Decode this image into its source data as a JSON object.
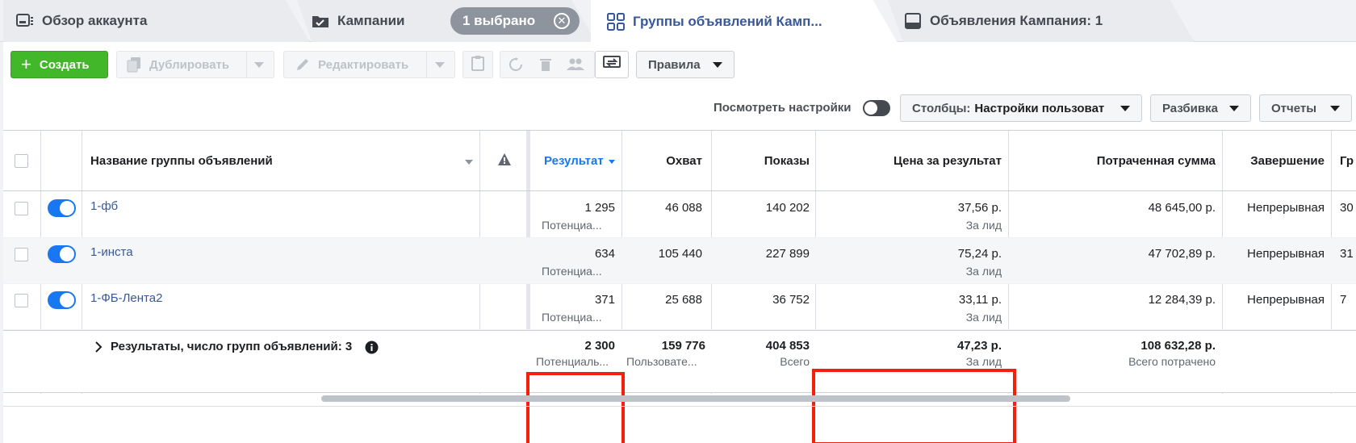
{
  "tabs": {
    "overview": "Обзор аккаунта",
    "campaigns": "Кампании",
    "selected": "1 выбрано",
    "adsets": "Группы объявлений Камп...",
    "ads": "Объявления Кампания: 1"
  },
  "toolbar": {
    "create": "Создать",
    "duplicate": "Дублировать",
    "edit": "Редактировать",
    "rules": "Правила"
  },
  "settings": {
    "view_settings": "Посмотреть настройки",
    "columns_prefix": "Столбцы:",
    "columns_value": "Настройки пользоват",
    "breakdown": "Разбивка",
    "reports": "Отчеты"
  },
  "table": {
    "headers": {
      "name": "Название группы объявлений",
      "results": "Результат",
      "reach": "Охват",
      "impressions": "Показы",
      "cost": "Цена за результат",
      "spent": "Потраченная сумма",
      "ending": "Завершение",
      "budget": "Гр"
    },
    "rows": [
      {
        "name": "1-фб",
        "results": "1 295",
        "results_sub": "Потенциа...",
        "reach": "46 088",
        "impressions": "140 202",
        "cost": "37,56 р.",
        "cost_sub": "За лид",
        "spent": "48 645,00 р.",
        "ending": "Непрерывная",
        "budget": "30"
      },
      {
        "name": "1-инста",
        "results": "634",
        "results_sub": "Потенциа...",
        "reach": "105 440",
        "impressions": "227 899",
        "cost": "75,24 р.",
        "cost_sub": "За лид",
        "spent": "47 702,89 р.",
        "ending": "Непрерывная",
        "budget": "31"
      },
      {
        "name": "1-ФБ-Лента2",
        "results": "371",
        "results_sub": "Потенциа...",
        "reach": "25 688",
        "impressions": "36 752",
        "cost": "33,11 р.",
        "cost_sub": "За лид",
        "spent": "12 284,39 р.",
        "ending": "Непрерывная",
        "budget": "7 "
      }
    ],
    "totals": {
      "label": "Результаты, число групп объявлений: 3",
      "results": "2 300",
      "results_sub": "Потенциаль...",
      "reach": "159 776",
      "reach_sub": "Пользовате...",
      "impressions": "404 853",
      "impressions_sub": "Всего",
      "cost": "47,23 р.",
      "cost_sub": "За лид",
      "spent": "108 632,28 р.",
      "spent_sub": "Всего потрачено"
    }
  },
  "colors": {
    "accent": "#1877f2",
    "create": "#42b72a",
    "highlight": "#f5200c",
    "link": "#385898"
  }
}
